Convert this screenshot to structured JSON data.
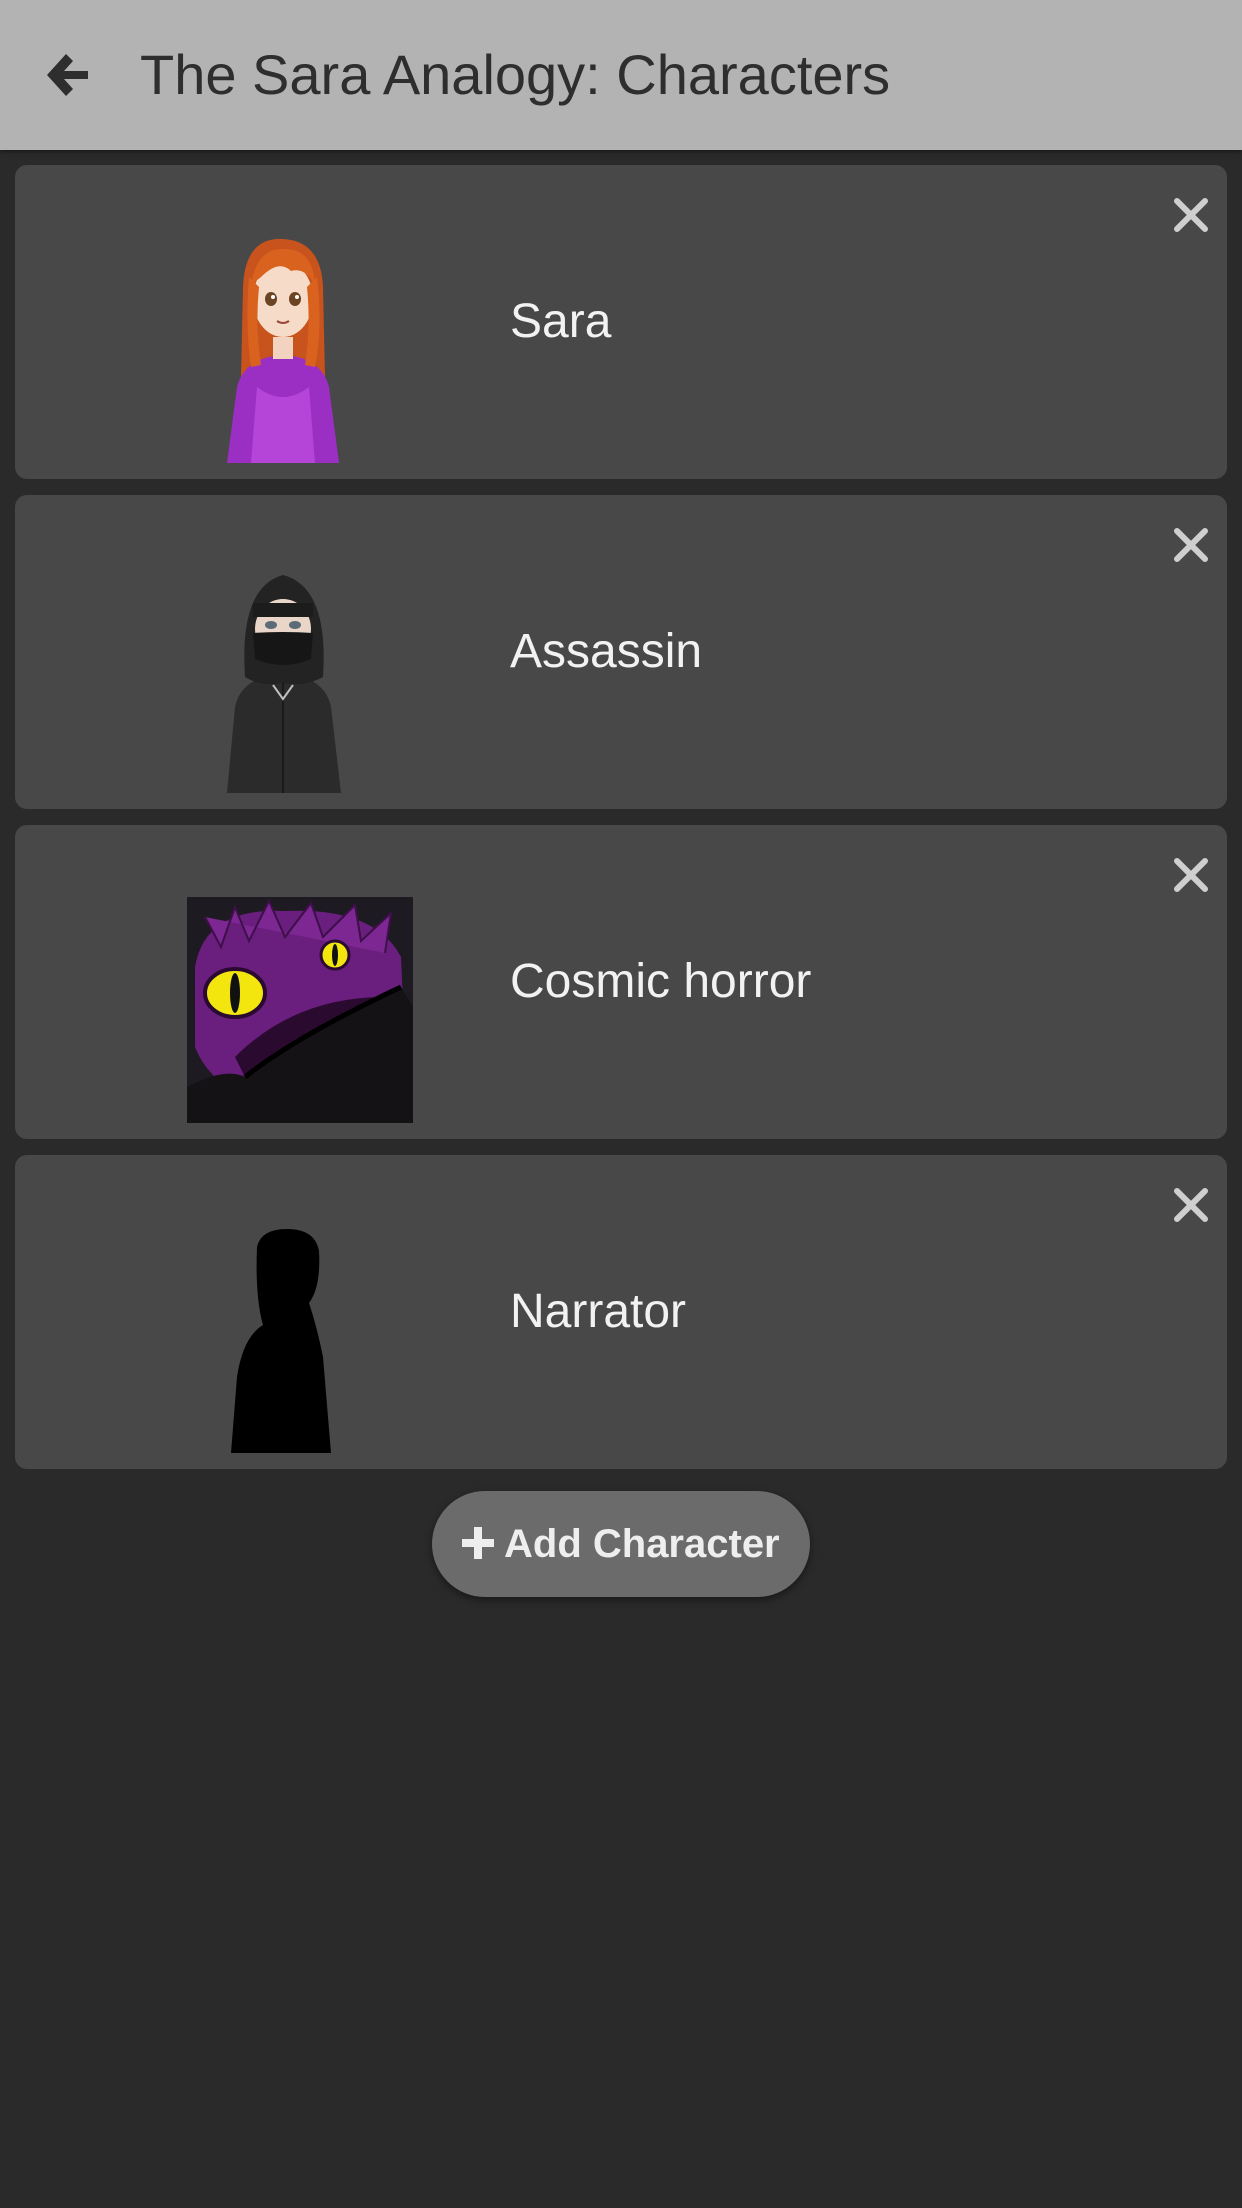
{
  "header": {
    "back_icon": "arrow-left-icon",
    "title": "The Sara Analogy: Characters"
  },
  "characters": [
    {
      "name": "Sara",
      "avatar": "sara-portrait",
      "remove_icon": "close-icon"
    },
    {
      "name": "Assassin",
      "avatar": "assassin-portrait",
      "remove_icon": "close-icon"
    },
    {
      "name": "Cosmic horror",
      "avatar": "cosmic-horror-portrait",
      "remove_icon": "close-icon"
    },
    {
      "name": "Narrator",
      "avatar": "silhouette-portrait",
      "remove_icon": "close-icon"
    }
  ],
  "add_button": {
    "icon": "plus-icon",
    "label": "Add Character"
  },
  "colors": {
    "header_bg": "#b3b3b3",
    "page_bg": "#2a2a2a",
    "card_bg": "#484848",
    "button_bg": "#6b6b6b"
  }
}
